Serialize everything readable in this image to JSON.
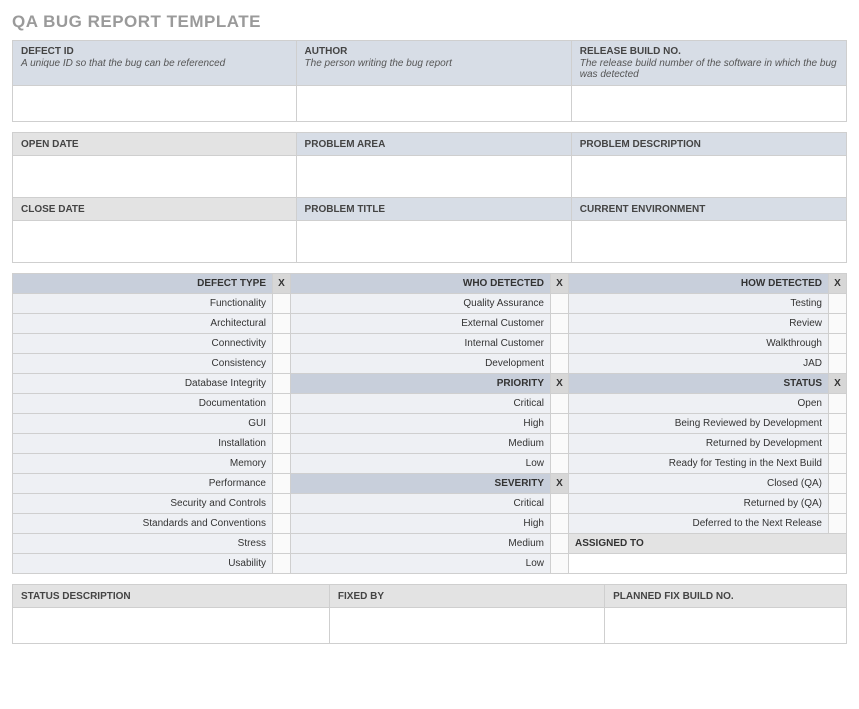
{
  "title": "QA BUG REPORT TEMPLATE",
  "top": {
    "defect_id": {
      "label": "DEFECT ID",
      "sub": "A unique ID so that the bug can be referenced"
    },
    "author": {
      "label": "AUTHOR",
      "sub": "The person writing the bug report"
    },
    "release": {
      "label": "RELEASE BUILD NO.",
      "sub": "The release build number of the software in which the bug was detected"
    }
  },
  "mid": {
    "open_date": "OPEN DATE",
    "problem_area": "PROBLEM AREA",
    "problem_desc": "PROBLEM DESCRIPTION",
    "close_date": "CLOSE DATE",
    "problem_title": "PROBLEM TITLE",
    "current_env": "CURRENT ENVIRONMENT"
  },
  "cat": {
    "x": "X",
    "defect_type": {
      "label": "DEFECT TYPE",
      "items": [
        "Functionality",
        "Architectural",
        "Connectivity",
        "Consistency",
        "Database Integrity",
        "Documentation",
        "GUI",
        "Installation",
        "Memory",
        "Performance",
        "Security and Controls",
        "Standards and Conventions",
        "Stress",
        "Usability"
      ]
    },
    "who": {
      "label": "WHO DETECTED",
      "items": [
        "Quality Assurance",
        "External Customer",
        "Internal Customer",
        "Development"
      ]
    },
    "priority": {
      "label": "PRIORITY",
      "items": [
        "Critical",
        "High",
        "Medium",
        "Low"
      ]
    },
    "severity": {
      "label": "SEVERITY",
      "items": [
        "Critical",
        "High",
        "Medium",
        "Low"
      ]
    },
    "how": {
      "label": "HOW DETECTED",
      "items": [
        "Testing",
        "Review",
        "Walkthrough",
        "JAD"
      ]
    },
    "status": {
      "label": "STATUS",
      "items": [
        "Open",
        "Being Reviewed by Development",
        "Returned by Development",
        "Ready for Testing in the Next Build",
        "Closed (QA)",
        "Returned by (QA)",
        "Deferred to the Next Release"
      ]
    },
    "assigned_to": "ASSIGNED TO"
  },
  "bottom": {
    "status_desc": "STATUS DESCRIPTION",
    "fixed_by": "FIXED BY",
    "planned_fix": "PLANNED FIX BUILD NO."
  }
}
